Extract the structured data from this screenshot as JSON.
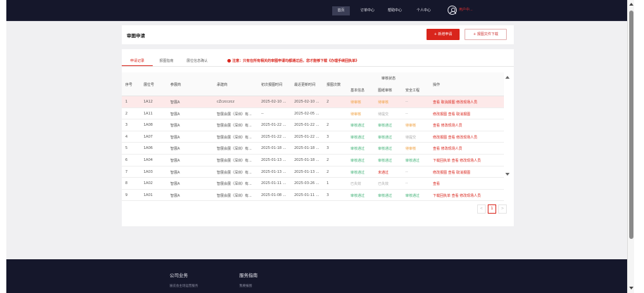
{
  "nav": {
    "items": [
      "首页",
      "订单中心",
      "帮助中心",
      "个人中心"
    ],
    "user_name": "用户中...",
    "accent": "#d9251c"
  },
  "header": {
    "title": "审图申请",
    "new_button": "+ 新增申请",
    "download_button": "+ 报图文件下载"
  },
  "tabs": [
    "申请记录",
    "报图指南",
    "展位信息确认"
  ],
  "notice": "注意：只有在所有相关的审图申请均都通过后，您才能够下载《办理手续回执单》",
  "table": {
    "headers": {
      "seq": "序号",
      "booth": "展位号",
      "exhibitor": "参展商",
      "builder": "承建商",
      "first_time": "初次报图时间",
      "last_update": "最近更新时间",
      "count": "报图次数",
      "review_status": "审核状态",
      "basic_info": "基本信息",
      "drawing_review": "图纸审核",
      "safety": "安全工程",
      "actions": "操作"
    },
    "rows": [
      {
        "seq": "1",
        "booth": "1A12",
        "exhibitor": "智展A",
        "builder": "cZczcczcz",
        "first": "2025-02-10 ...",
        "last": "2025-02-10 ...",
        "count": "2",
        "basic": "待审核",
        "drawing": "待审核",
        "safety": "--",
        "actions": "查看 取消报图 修改现场人员"
      },
      {
        "seq": "2",
        "booth": "1A11",
        "exhibitor": "智展A",
        "builder": "智展会展（深圳）有...",
        "first": "--",
        "last": "2025-02-05 ...",
        "count": "",
        "basic": "待审核",
        "drawing": "待提交",
        "safety": "--",
        "actions": "修改报图 查看 取消报图"
      },
      {
        "seq": "3",
        "booth": "1A08",
        "exhibitor": "智展A",
        "builder": "智展会展（深圳）有...",
        "first": "2025-01-22 ...",
        "last": "2025-01-22 ...",
        "count": "2",
        "basic": "审核通过",
        "drawing": "审核通过",
        "safety": "待审核",
        "actions": "查看 修改现场人员"
      },
      {
        "seq": "4",
        "booth": "1A07",
        "exhibitor": "智展A",
        "builder": "智展会展（深圳）有...",
        "first": "2025-01-22 ...",
        "last": "2025-01-22 ...",
        "count": "3",
        "basic": "审核通过",
        "drawing": "审核通过",
        "safety": "待提交",
        "actions": "修改报图 查看 修改现场人员"
      },
      {
        "seq": "5",
        "booth": "1A06",
        "exhibitor": "智展A",
        "builder": "智展会展（深圳）有...",
        "first": "2025-01-18 ...",
        "last": "2025-01-18 ...",
        "count": "3",
        "basic": "审核通过",
        "drawing": "审核通过",
        "safety": "待审核",
        "actions": "查看 修改现场人员"
      },
      {
        "seq": "6",
        "booth": "1A04",
        "exhibitor": "智展A",
        "builder": "智展会展（深圳）有...",
        "first": "2025-01-13 ...",
        "last": "2025-01-18 ...",
        "count": "2",
        "basic": "审核通过",
        "drawing": "审核通过",
        "safety": "审核通过",
        "actions": "下载回执单 查看 修改现场人员"
      },
      {
        "seq": "7",
        "booth": "1A03",
        "exhibitor": "智展A",
        "builder": "智展会展（深圳）有...",
        "first": "2025-01-13 ...",
        "last": "2025-01-13 ...",
        "count": "2",
        "basic": "审核通过",
        "drawing": "未通过",
        "safety": "--",
        "actions": "修改报图 查看 取消报图"
      },
      {
        "seq": "8",
        "booth": "1A02",
        "exhibitor": "智展A",
        "builder": "智展会展（深圳）有...",
        "first": "2025-01-11 ...",
        "last": "2025-03-26 ...",
        "count": "1",
        "basic": "已失效",
        "drawing": "已失效",
        "safety": "--",
        "actions": "查看"
      },
      {
        "seq": "9",
        "booth": "1A01",
        "exhibitor": "智展A",
        "builder": "智展会展（深圳）有...",
        "first": "2025-01-08 ...",
        "last": "2025-01-11 ...",
        "count": "3",
        "basic": "审核通过",
        "drawing": "审核通过",
        "safety": "审核通过",
        "actions": "下载回执单 查看 修改现场人员"
      }
    ]
  },
  "pagination": {
    "prev": "<",
    "current": "1",
    "next": ">"
  },
  "footer": {
    "col1_title": "公司业务",
    "col1_link": "展览会主场运营服务",
    "col2_title": "服务指南",
    "col2_link": "我要报图"
  }
}
